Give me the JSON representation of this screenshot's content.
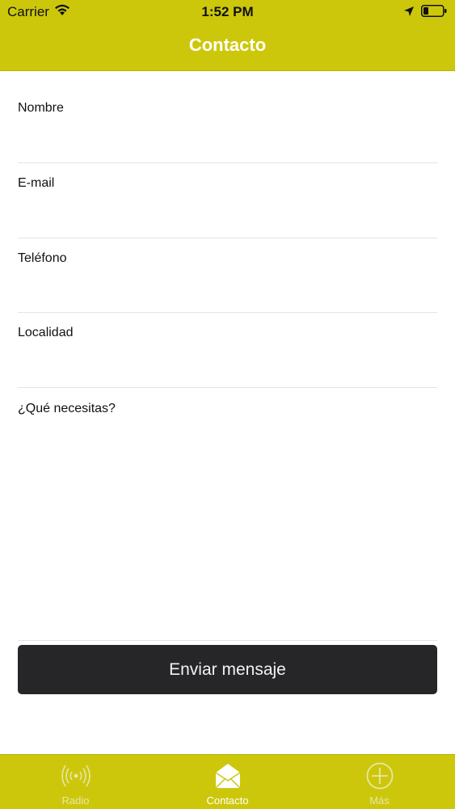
{
  "status_bar": {
    "carrier": "Carrier",
    "time": "1:52 PM"
  },
  "header": {
    "title": "Contacto"
  },
  "form": {
    "fields": [
      {
        "label": "Nombre",
        "value": ""
      },
      {
        "label": "E-mail",
        "value": ""
      },
      {
        "label": "Teléfono",
        "value": ""
      },
      {
        "label": "Localidad",
        "value": ""
      },
      {
        "label": "¿Qué necesitas?",
        "value": ""
      }
    ],
    "submit_label": "Enviar mensaje"
  },
  "tabbar": {
    "tabs": [
      {
        "label": "Radio",
        "icon": "radio-broadcast-icon",
        "active": false
      },
      {
        "label": "Contacto",
        "icon": "envelope-icon",
        "active": true
      },
      {
        "label": "Más",
        "icon": "plus-circle-icon",
        "active": false
      }
    ]
  },
  "colors": {
    "accent": "#cdc70c",
    "button_bg": "#262628",
    "text": "#111111"
  }
}
